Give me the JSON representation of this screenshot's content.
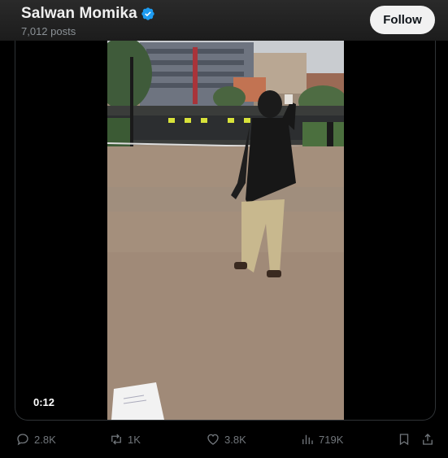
{
  "header": {
    "name": "Salwan Momika",
    "posts": "7,012 posts",
    "follow_label": "Follow"
  },
  "video": {
    "timestamp": "0:12"
  },
  "actions": {
    "replies": "2.8K",
    "reposts": "1K",
    "likes": "3.8K",
    "views": "719K"
  },
  "icons": [
    "verified-badge-icon",
    "reply-icon",
    "repost-icon",
    "like-icon",
    "views-icon",
    "bookmark-icon",
    "share-icon"
  ],
  "colors": {
    "verified": "#1d9bf0",
    "background": "#000000",
    "muted": "#71767b"
  }
}
